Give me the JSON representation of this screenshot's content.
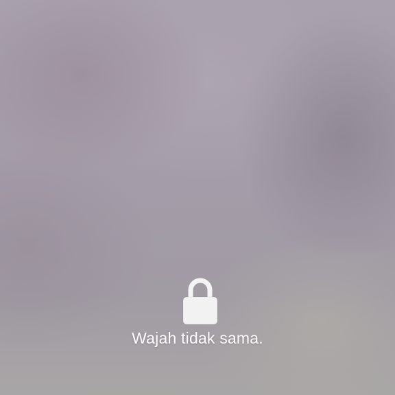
{
  "lock_screen": {
    "status_icon": "lock-icon",
    "message": "Wajah tidak sama."
  },
  "colors": {
    "icon": "#ffffff",
    "text": "#ffffff"
  }
}
